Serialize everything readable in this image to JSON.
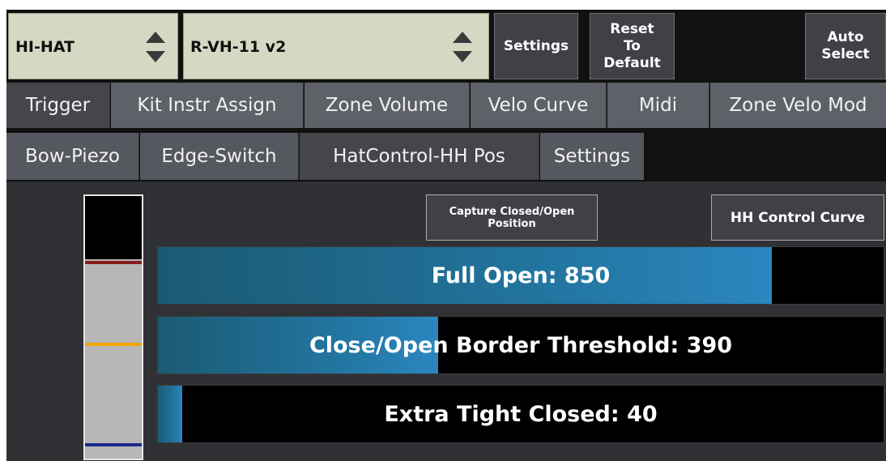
{
  "topbar": {
    "instrument_select": {
      "value": "HI-HAT"
    },
    "kit_select": {
      "value": "R-VH-11 v2"
    },
    "settings_label": "Settings",
    "reset_label": "Reset\nTo\nDefault",
    "auto_select_label": "Auto\nSelect"
  },
  "tabs_main": [
    {
      "label": "Trigger",
      "active": true
    },
    {
      "label": "Kit Instr Assign",
      "active": false
    },
    {
      "label": "Zone Volume",
      "active": false
    },
    {
      "label": "Velo Curve",
      "active": false
    },
    {
      "label": "Midi",
      "active": false
    },
    {
      "label": "Zone Velo Mod",
      "active": false
    }
  ],
  "tabs_sub": [
    {
      "label": "Bow-Piezo",
      "active": false
    },
    {
      "label": "Edge-Switch",
      "active": false
    },
    {
      "label": "HatControl-HH Pos",
      "active": true
    },
    {
      "label": "Settings",
      "active": false
    }
  ],
  "panel": {
    "capture_label": "Capture Closed/Open\nPosition",
    "curve_label": "HH Control Curve",
    "position_meter": {
      "marker_colors": [
        "#8b1a1a",
        "#f0a500",
        "#1a2a8b"
      ]
    },
    "sliders": [
      {
        "label": "Full Open: 850",
        "fill_fraction": 0.846
      },
      {
        "label": "Close/Open Border Threshold: 390",
        "fill_fraction": 0.386
      },
      {
        "label": "Extra Tight Closed: 40",
        "fill_fraction": 0.034
      }
    ]
  },
  "colors": {
    "accent_blue": "#2378a5",
    "select_bg": "#d7d8c4",
    "button_bg": "#3f4146"
  }
}
